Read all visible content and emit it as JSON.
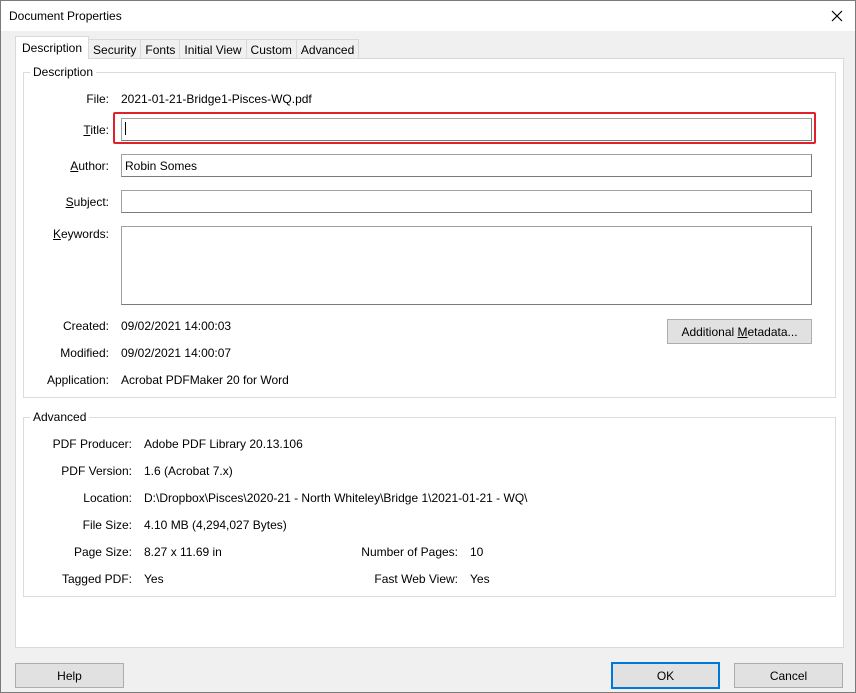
{
  "window": {
    "title": "Document Properties"
  },
  "tabs": [
    {
      "label": "Description",
      "active": true
    },
    {
      "label": "Security"
    },
    {
      "label": "Fonts"
    },
    {
      "label": "Initial View"
    },
    {
      "label": "Custom"
    },
    {
      "label": "Advanced"
    }
  ],
  "description": {
    "group_label": "Description",
    "file_label": "File:",
    "file_value": "2021-01-21-Bridge1-Pisces-WQ.pdf",
    "title_label": "Title:",
    "title_value": "",
    "author_label": "Author:",
    "author_value": "Robin Somes",
    "subject_label": "Subject:",
    "subject_value": "",
    "keywords_label": "Keywords:",
    "keywords_value": "",
    "created_label": "Created:",
    "created_value": "09/02/2021 14:00:03",
    "modified_label": "Modified:",
    "modified_value": "09/02/2021 14:00:07",
    "application_label": "Application:",
    "application_value": "Acrobat PDFMaker 20 for Word",
    "metadata_button": "Additional Metadata..."
  },
  "advanced": {
    "group_label": "Advanced",
    "producer_label": "PDF Producer:",
    "producer_value": "Adobe PDF Library 20.13.106",
    "version_label": "PDF Version:",
    "version_value": "1.6 (Acrobat 7.x)",
    "location_label": "Location:",
    "location_value": "D:\\Dropbox\\Pisces\\2020-21 - North Whiteley\\Bridge 1\\2021-01-21 - WQ\\",
    "filesize_label": "File Size:",
    "filesize_value": "4.10 MB (4,294,027 Bytes)",
    "pagesize_label": "Page Size:",
    "pagesize_value": "8.27 x 11.69 in",
    "numpages_label": "Number of Pages:",
    "numpages_value": "10",
    "tagged_label": "Tagged PDF:",
    "tagged_value": "Yes",
    "fastweb_label": "Fast Web View:",
    "fastweb_value": "Yes"
  },
  "footer": {
    "help": "Help",
    "ok": "OK",
    "cancel": "Cancel"
  },
  "colors": {
    "highlight": "#e0202a",
    "default_button_border": "#0078d7"
  }
}
